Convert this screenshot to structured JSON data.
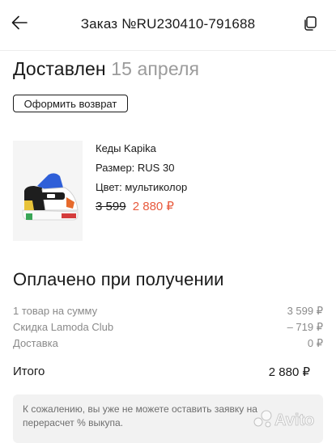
{
  "header": {
    "title": "Заказ №RU230410-791688",
    "back_icon": "arrow-left-icon",
    "copy_icon": "copy-icon"
  },
  "order": {
    "status": "Доставлен",
    "status_date": "15 апреля",
    "return_button_label": "Оформить возврат"
  },
  "product": {
    "name": "Кеды Kapika",
    "size": "Размер: RUS 30",
    "color": "Цвет: мультиколор",
    "old_price": "3 599",
    "new_price": "2 880 ₽"
  },
  "payment": {
    "title": "Оплачено при получении",
    "rows": [
      {
        "label": "1 товар на сумму",
        "value": "3 599 ₽"
      },
      {
        "label": "Скидка Lamoda Club",
        "value": "– 719 ₽"
      },
      {
        "label": "Доставка",
        "value": "0 ₽"
      }
    ],
    "total_label": "Итого",
    "total_value": "2 880 ₽"
  },
  "notice": {
    "text": "К сожалению, вы уже не можете оставить заявку на перерасчет % выкупа."
  },
  "watermark": {
    "brand": "Avito"
  },
  "colors": {
    "accent_price": "#e85a3d",
    "muted": "#8a8a8a",
    "notice_bg": "#f2f2f2"
  }
}
